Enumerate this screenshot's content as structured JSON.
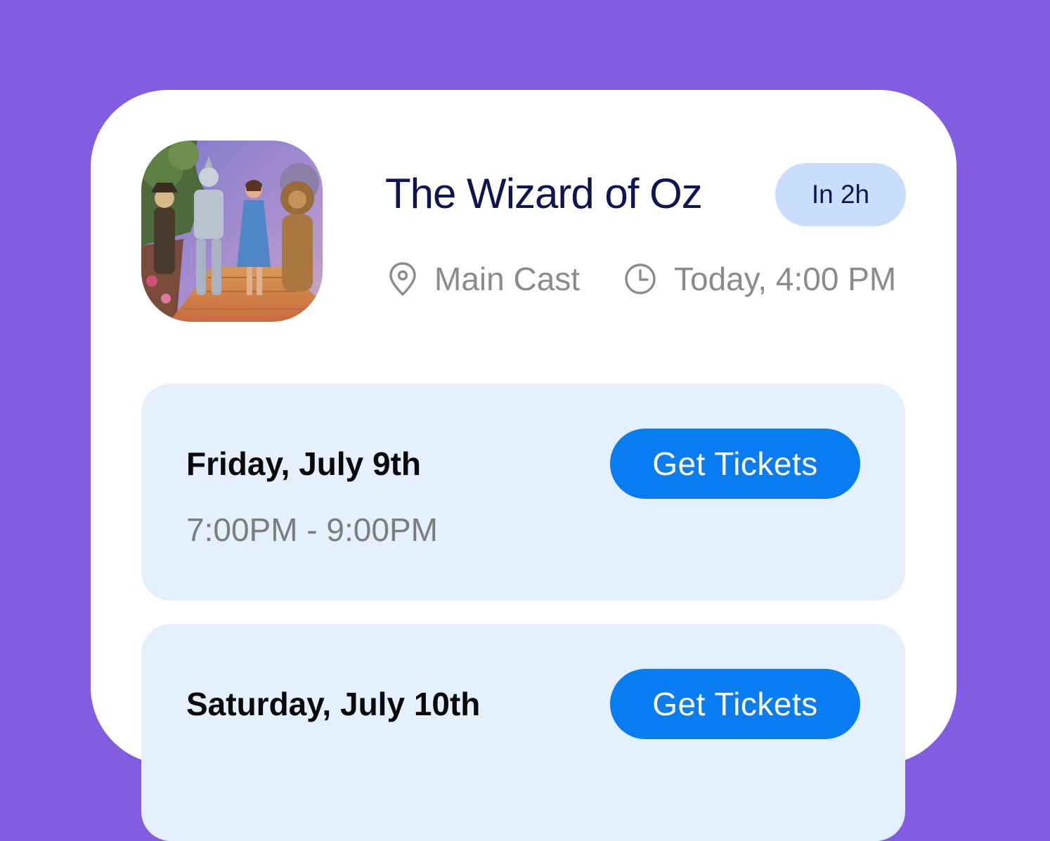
{
  "event": {
    "title": "The Wizard of Oz",
    "badge": "In 2h",
    "location": "Main Cast",
    "time": "Today, 4:00 PM",
    "location_icon": "map-pin-icon",
    "time_icon": "clock-icon"
  },
  "sessions": [
    {
      "date": "Friday, July 9th",
      "time_range": "7:00PM - 9:00PM",
      "button_label": "Get Tickets"
    },
    {
      "date": "Saturday, July 10th",
      "time_range": "",
      "button_label": "Get Tickets"
    }
  ],
  "colors": {
    "background": "#825de2",
    "card": "#ffffff",
    "title": "#0e1550",
    "badge_bg": "#c8defc",
    "session_bg": "#e4f0fd",
    "button": "#0a7cf2",
    "muted_text": "#8b8b8b"
  }
}
